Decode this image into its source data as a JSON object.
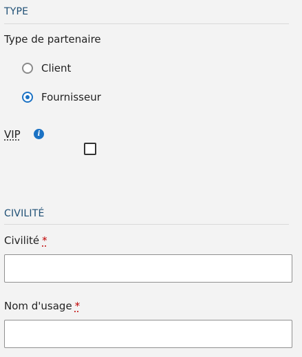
{
  "type_section": {
    "heading": "TYPE",
    "partner_type_label": "Type de partenaire",
    "options": [
      {
        "label": "Client",
        "checked": false
      },
      {
        "label": "Fournisseur",
        "checked": true
      }
    ],
    "vip_label": "VIP",
    "vip_info_icon": "info-icon",
    "vip_checked": false
  },
  "civility_section": {
    "heading": "CIVILITÉ",
    "civility_label": "Civilité",
    "civility_value": "",
    "usage_name_label": "Nom d'usage",
    "usage_name_value": "",
    "required_marker": "*"
  },
  "colors": {
    "heading": "#1d4e74",
    "accent": "#1b72c4",
    "required": "#c00000",
    "background": "#f3f3f3"
  }
}
